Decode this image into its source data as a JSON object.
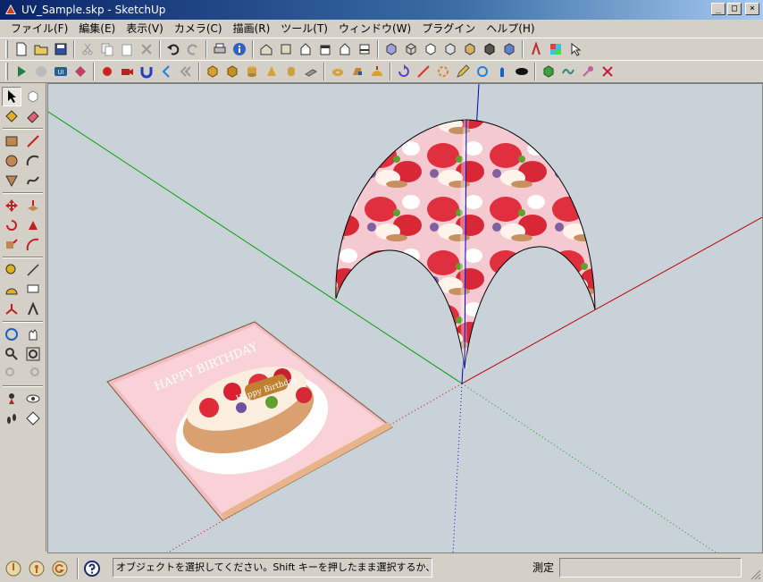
{
  "window": {
    "title": "UV_Sample.skp - SketchUp",
    "min_label": "_",
    "max_label": "□",
    "close_label": "×"
  },
  "menu": {
    "items": [
      "ファイル(F)",
      "編集(E)",
      "表示(V)",
      "カメラ(C)",
      "描画(R)",
      "ツール(T)",
      "ウィンドウ(W)",
      "プラグイン",
      "ヘルプ(H)"
    ]
  },
  "scene": {
    "texture_text": "HAPPY BIRTHDAY",
    "cake_label": "Happy Birthday"
  },
  "status": {
    "message": "オブジェクトを選択してください。Shift キーを押したまま選択するか、ま",
    "measure_label": "測定",
    "measure_value": ""
  },
  "colors": {
    "viewport_bg": "#c8d2d8",
    "axis_red": "#c00000",
    "axis_green": "#00a000",
    "axis_blue": "#0000c8",
    "chrome": "#d4d0c8"
  }
}
